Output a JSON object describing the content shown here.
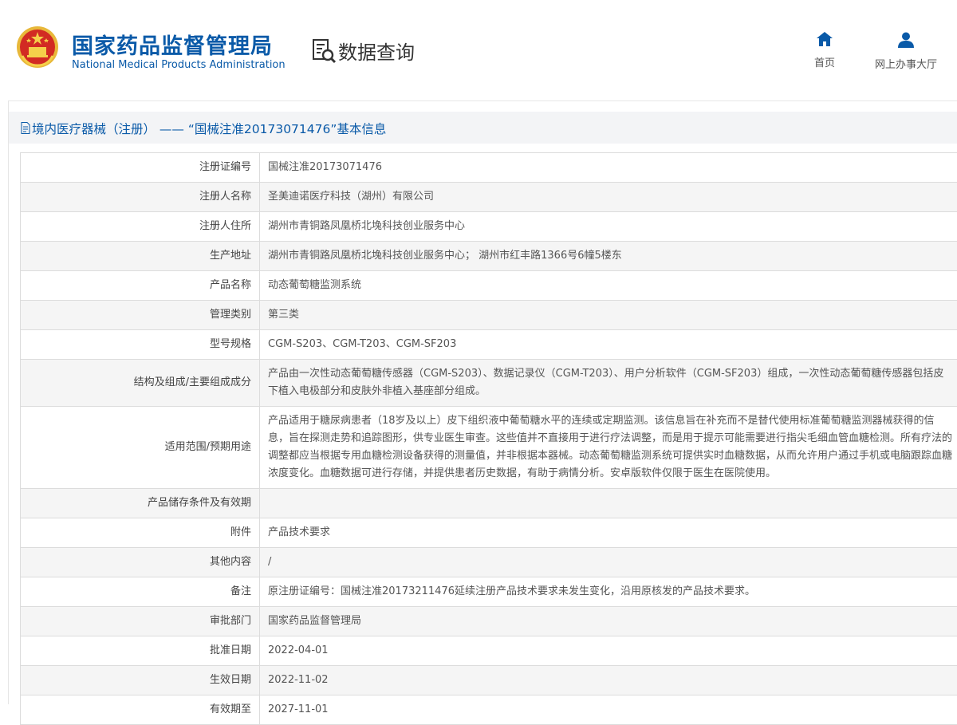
{
  "header": {
    "brand_cn": "国家药品监督管理局",
    "brand_en": "National Medical Products Administration",
    "query_title": "数据查询",
    "nav": [
      {
        "label": "首页",
        "icon": "home-icon"
      },
      {
        "label": "网上办事大厅",
        "icon": "user-icon"
      }
    ],
    "accent_color": "#0a5aa8"
  },
  "page": {
    "title": "境内医疗器械（注册） —— “国械注准20173071476”基本信息"
  },
  "rows": [
    {
      "label": "注册证编号",
      "value": "国械注准20173071476"
    },
    {
      "label": "注册人名称",
      "value": "圣美迪诺医疗科技（湖州）有限公司"
    },
    {
      "label": "注册人住所",
      "value": "湖州市青铜路凤凰桥北堍科技创业服务中心"
    },
    {
      "label": "生产地址",
      "value": "湖州市青铜路凤凰桥北堍科技创业服务中心； 湖州市红丰路1366号6幢5楼东"
    },
    {
      "label": "产品名称",
      "value": "动态葡萄糖监测系统"
    },
    {
      "label": "管理类别",
      "value": "第三类"
    },
    {
      "label": "型号规格",
      "value": "CGM-S203、CGM-T203、CGM-SF203"
    },
    {
      "label": "结构及组成/主要组成成分",
      "value": "产品由一次性动态葡萄糖传感器（CGM-S203）、数据记录仪（CGM-T203）、用户分析软件（CGM-SF203）组成，一次性动态葡萄糖传感器包括皮下植入电极部分和皮肤外非植入基座部分组成。"
    },
    {
      "label": "适用范围/预期用途",
      "value": "产品适用于糖尿病患者（18岁及以上）皮下组织液中葡萄糖水平的连续或定期监测。该信息旨在补充而不是替代使用标准葡萄糖监测器械获得的信息，旨在探测走势和追踪图形，供专业医生审查。这些值并不直接用于进行疗法调整，而是用于提示可能需要进行指尖毛细血管血糖检测。所有疗法的调整都应当根据专用血糖检测设备获得的测量值，并非根据本器械。动态葡萄糖监测系统可提供实时血糖数据，从而允许用户通过手机或电脑跟踪血糖浓度变化。血糖数据可进行存储，并提供患者历史数据，有助于病情分析。安卓版软件仅限于医生在医院使用。"
    },
    {
      "label": "产品储存条件及有效期",
      "value": ""
    },
    {
      "label": "附件",
      "value": "产品技术要求"
    },
    {
      "label": "其他内容",
      "value": "/"
    },
    {
      "label": "备注",
      "value": "原注册证编号：国械注准20173211476延续注册产品技术要求未发生变化，沿用原核发的产品技术要求。"
    },
    {
      "label": "审批部门",
      "value": "国家药品监督管理局"
    },
    {
      "label": "批准日期",
      "value": "2022-04-01"
    },
    {
      "label": "生效日期",
      "value": "2022-11-02"
    },
    {
      "label": "有效期至",
      "value": "2027-11-01"
    }
  ]
}
